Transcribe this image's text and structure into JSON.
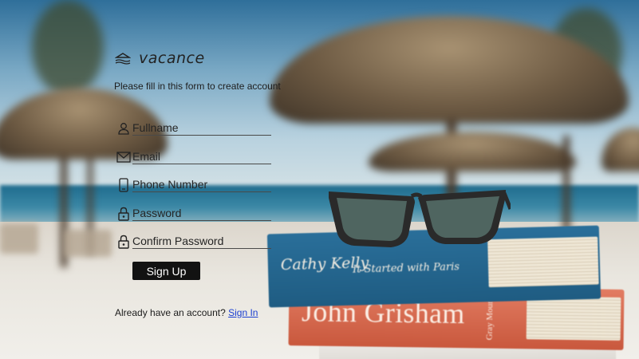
{
  "app": {
    "logo_name": "vacance"
  },
  "form": {
    "subtitle": "Please fill in this form to create account",
    "fields": [
      {
        "placeholder": "Fullname",
        "icon": "user-icon"
      },
      {
        "placeholder": "Email",
        "icon": "mail-icon"
      },
      {
        "placeholder": "Phone Number",
        "icon": "phone-icon"
      },
      {
        "placeholder": "Password",
        "icon": "lock-icon"
      },
      {
        "placeholder": "Confirm Password",
        "icon": "lock-icon"
      }
    ],
    "submit_label": "Sign Up",
    "signin_prompt": "Already have an account?",
    "signin_link": "Sign In"
  },
  "background": {
    "books": {
      "blue_author": "Cathy Kelly",
      "blue_title": "It Started with Paris",
      "red_author": "John Grisham",
      "red_spine": "Gray Mountain"
    }
  },
  "colors": {
    "button": "#121212",
    "link": "#1a3fd1"
  }
}
